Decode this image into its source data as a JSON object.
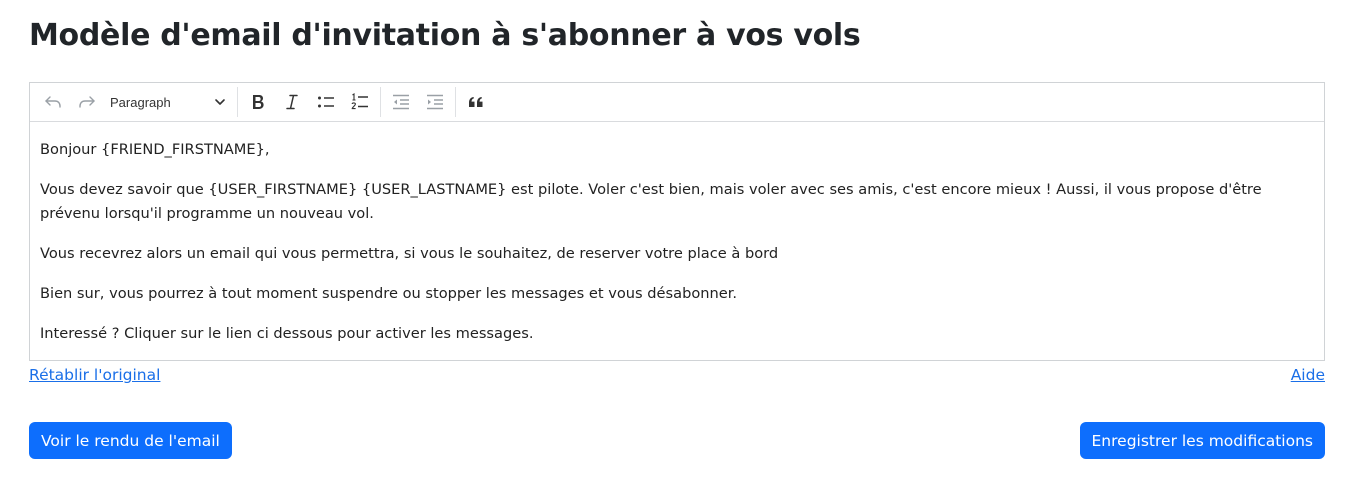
{
  "page": {
    "title": "Modèle d'email d'invitation à s'abonner à vos vols"
  },
  "editor": {
    "toolbar": {
      "heading_value": "Paragraph",
      "icons": [
        "undo-icon",
        "redo-icon",
        "chevron-down-icon",
        "bold-icon",
        "italic-icon",
        "bulleted-list-icon",
        "numbered-list-icon",
        "outdent-icon",
        "indent-icon",
        "blockquote-icon"
      ]
    },
    "paragraphs": [
      "Bonjour {FRIEND_FIRSTNAME},",
      "Vous devez savoir que {USER_FIRSTNAME} {USER_LASTNAME} est pilote. Voler c'est bien, mais voler avec ses amis, c'est encore mieux ! Aussi, il vous propose d'être prévenu lorsqu'il programme un nouveau vol.",
      "Vous recevrez alors un email qui vous permettra, si vous le souhaitez, de reserver votre place à bord",
      "Bien sur, vous pourrez à tout moment suspendre ou stopper les messages et vous désabonner.",
      "Interessé ? Cliquer sur le lien ci dessous pour activer les messages."
    ]
  },
  "links": {
    "restore": "Rétablir l'original",
    "help": "Aide"
  },
  "buttons": {
    "preview": "Voir le rendu de l'email",
    "save": "Enregistrer les modifications"
  },
  "colors": {
    "primary": "#0d6efd",
    "link": "#1a6fe8",
    "border": "#d0d3d6"
  }
}
